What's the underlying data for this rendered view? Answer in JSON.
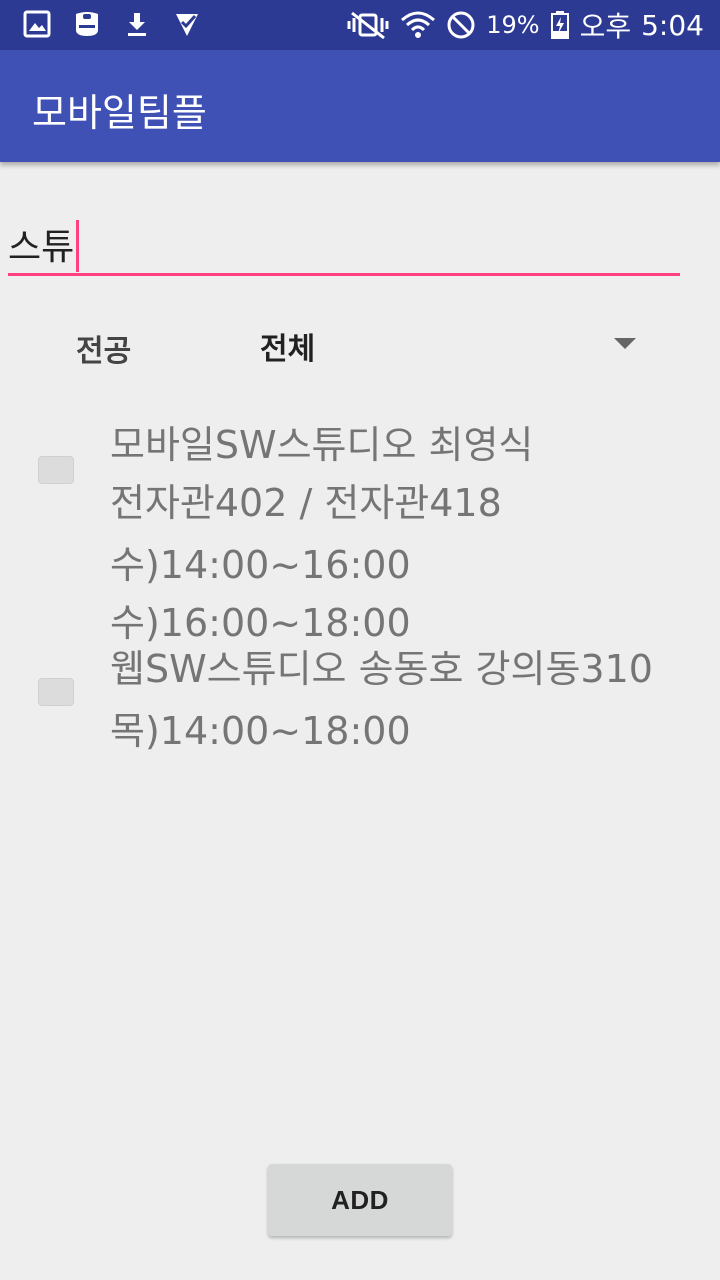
{
  "status_bar": {
    "left_icons": [
      "gallery-icon",
      "galaxy-icon",
      "download-icon",
      "task-check-icon"
    ],
    "right_icons": [
      "mute-vibrate-icon",
      "wifi-icon",
      "no-disturb-icon",
      "battery-icon"
    ],
    "battery_percent": "19%",
    "ampm": "오후",
    "time": "5:04"
  },
  "app_bar": {
    "title": "모바일팀플",
    "color": "#3f51b5"
  },
  "search": {
    "value": "스튜",
    "underline_color": "#ff4081"
  },
  "major": {
    "label": "전공",
    "selected": "전체"
  },
  "courses": [
    {
      "checked": false,
      "lines": [
        "모바일SW스튜디오 최영식",
        "전자관402 / 전자관418",
        "수)14:00~16:00",
        "수)16:00~18:00"
      ]
    },
    {
      "checked": false,
      "lines": [
        "웹SW스튜디오 송동호 강의동310",
        "목)14:00~18:00"
      ]
    }
  ],
  "add_button": {
    "label": "ADD"
  }
}
